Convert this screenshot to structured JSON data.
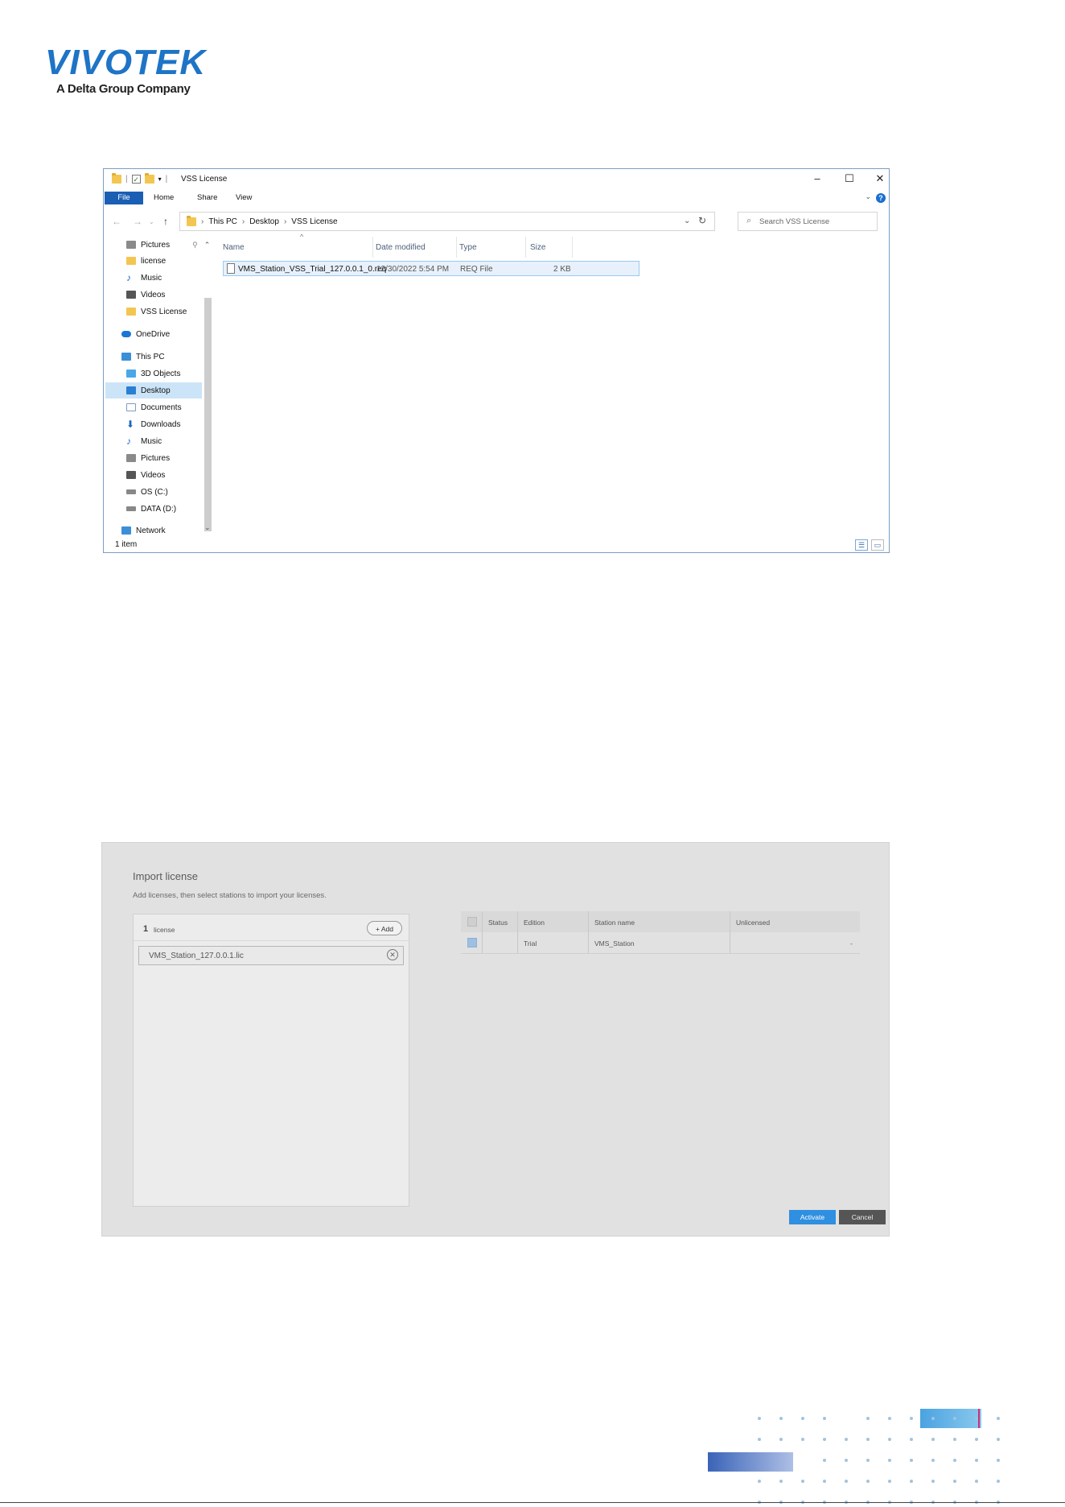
{
  "logo": {
    "word": "VIVOTEK",
    "tagline": "A Delta Group Company"
  },
  "explorer": {
    "window_title": "VSS License",
    "ribbon_tabs": [
      "File",
      "Home",
      "Share",
      "View"
    ],
    "breadcrumb": [
      "This PC",
      "Desktop",
      "VSS License"
    ],
    "search_placeholder": "Search VSS License",
    "sidebar": [
      {
        "label": "Pictures",
        "icon": "pictures-icon",
        "pinned": true
      },
      {
        "label": "license",
        "icon": "folder-icon"
      },
      {
        "label": "Music",
        "icon": "music-icon"
      },
      {
        "label": "Videos",
        "icon": "videos-icon"
      },
      {
        "label": "VSS License",
        "icon": "folder-icon"
      },
      {
        "label": "OneDrive",
        "icon": "onedrive-icon"
      },
      {
        "label": "This PC",
        "icon": "this-pc-icon"
      },
      {
        "label": "3D Objects",
        "icon": "3d-objects-icon"
      },
      {
        "label": "Desktop",
        "icon": "desktop-icon",
        "selected": true
      },
      {
        "label": "Documents",
        "icon": "documents-icon"
      },
      {
        "label": "Downloads",
        "icon": "downloads-icon"
      },
      {
        "label": "Music",
        "icon": "music-icon"
      },
      {
        "label": "Pictures",
        "icon": "pictures-icon"
      },
      {
        "label": "Videos",
        "icon": "videos-icon"
      },
      {
        "label": "OS (C:)",
        "icon": "drive-icon"
      },
      {
        "label": "DATA (D:)",
        "icon": "drive-icon"
      },
      {
        "label": "Network",
        "icon": "network-icon"
      }
    ],
    "columns": [
      "Name",
      "Date modified",
      "Type",
      "Size"
    ],
    "files": [
      {
        "name": "VMS_Station_VSS_Trial_127.0.0.1_0.req",
        "date": "12/30/2022 5:54 PM",
        "type": "REQ File",
        "size": "2 KB"
      }
    ],
    "status": "1 item"
  },
  "import_license": {
    "title": "Import license",
    "subtitle": "Add licenses, then select stations to import your licenses.",
    "count": "1",
    "count_label": "license",
    "add_label": "+ Add",
    "license_file": "VMS_Station_127.0.0.1.lic",
    "table": {
      "headers": [
        "Status",
        "Edition",
        "Station name",
        "Unlicensed"
      ],
      "rows": [
        {
          "status": "",
          "edition": "Trial",
          "station": "VMS_Station",
          "unlicensed": "-",
          "checked": true
        }
      ]
    },
    "activate_label": "Activate",
    "cancel_label": "Cancel",
    "colors": {
      "activate": "#2f8fe0",
      "cancel": "#555555"
    }
  }
}
